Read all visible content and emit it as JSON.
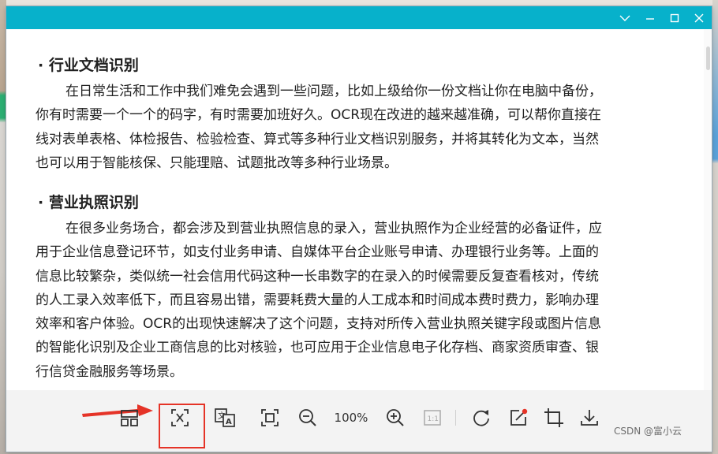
{
  "window": {
    "title_bar_color": "#07b1cb",
    "controls": [
      {
        "name": "collapse",
        "icon": "chevron-down-icon"
      },
      {
        "name": "minimize",
        "icon": "minimize-icon"
      },
      {
        "name": "maximize",
        "icon": "maximize-icon"
      },
      {
        "name": "close",
        "icon": "close-icon"
      }
    ]
  },
  "document": {
    "section1": {
      "heading": "·  行业文档识别",
      "lines": [
        "在日常生活和工作中我们难免会遇到一些问题，比如上级给你一份文档让你在电脑中备份，",
        "你有时需要一个一个的码字，有时需要加班好久。OCR现在改进的越来越准确，可以帮你直接在",
        "线对表单表格、体检报告、检验检查、算式等多种行业文档识别服务，并将其转化为文本，当然",
        "也可以用于智能核保、只能理赔、试题批改等多种行业场景。"
      ]
    },
    "section2": {
      "heading": "· 营业执照识别",
      "lines": [
        "在很多业务场合，都会涉及到营业执照信息的录入，营业执照作为企业经营的必备证件，应",
        "用于企业信息登记环节，如支付业务申请、自媒体平台企业账号申请、办理银行业务等。上面的",
        "信息比较繁杂，类似统一社会信用代码这种一长串数字的在录入的时候需要反复查看核对，传统",
        "的人工录入效率低下，而且容易出错，需要耗费大量的人工成本和时间成本费时费力，影响办理",
        "效率和客户体验。OCR的出现快速解决了这个问题，支持对所传入营业执照关键字段或图片信息",
        "的智能化识别及企业工商信息的比对核验，也可应用于企业信息电子化存档、商家资质审查、银",
        "行信贷金融服务等场景。"
      ]
    }
  },
  "toolbar": {
    "zoom_label": "100%",
    "buttons": [
      {
        "name": "thumbnails",
        "icon": "grid-icon"
      },
      {
        "name": "extract-text",
        "icon": "text-extract-icon",
        "highlighted": true
      },
      {
        "name": "translate",
        "icon": "translate-icon"
      },
      {
        "name": "fit-screen",
        "icon": "fit-screen-icon"
      },
      {
        "name": "zoom-out",
        "icon": "zoom-out-icon"
      },
      {
        "name": "zoom-in",
        "icon": "zoom-in-icon"
      },
      {
        "name": "actual-size",
        "icon": "one-to-one-icon",
        "label": "1:1"
      },
      {
        "name": "rotate",
        "icon": "rotate-icon"
      },
      {
        "name": "edit",
        "icon": "edit-icon"
      },
      {
        "name": "crop",
        "icon": "crop-icon"
      },
      {
        "name": "download",
        "icon": "download-icon"
      }
    ],
    "annotation_color": "#e53327"
  },
  "watermark": "CSDN @富小云"
}
